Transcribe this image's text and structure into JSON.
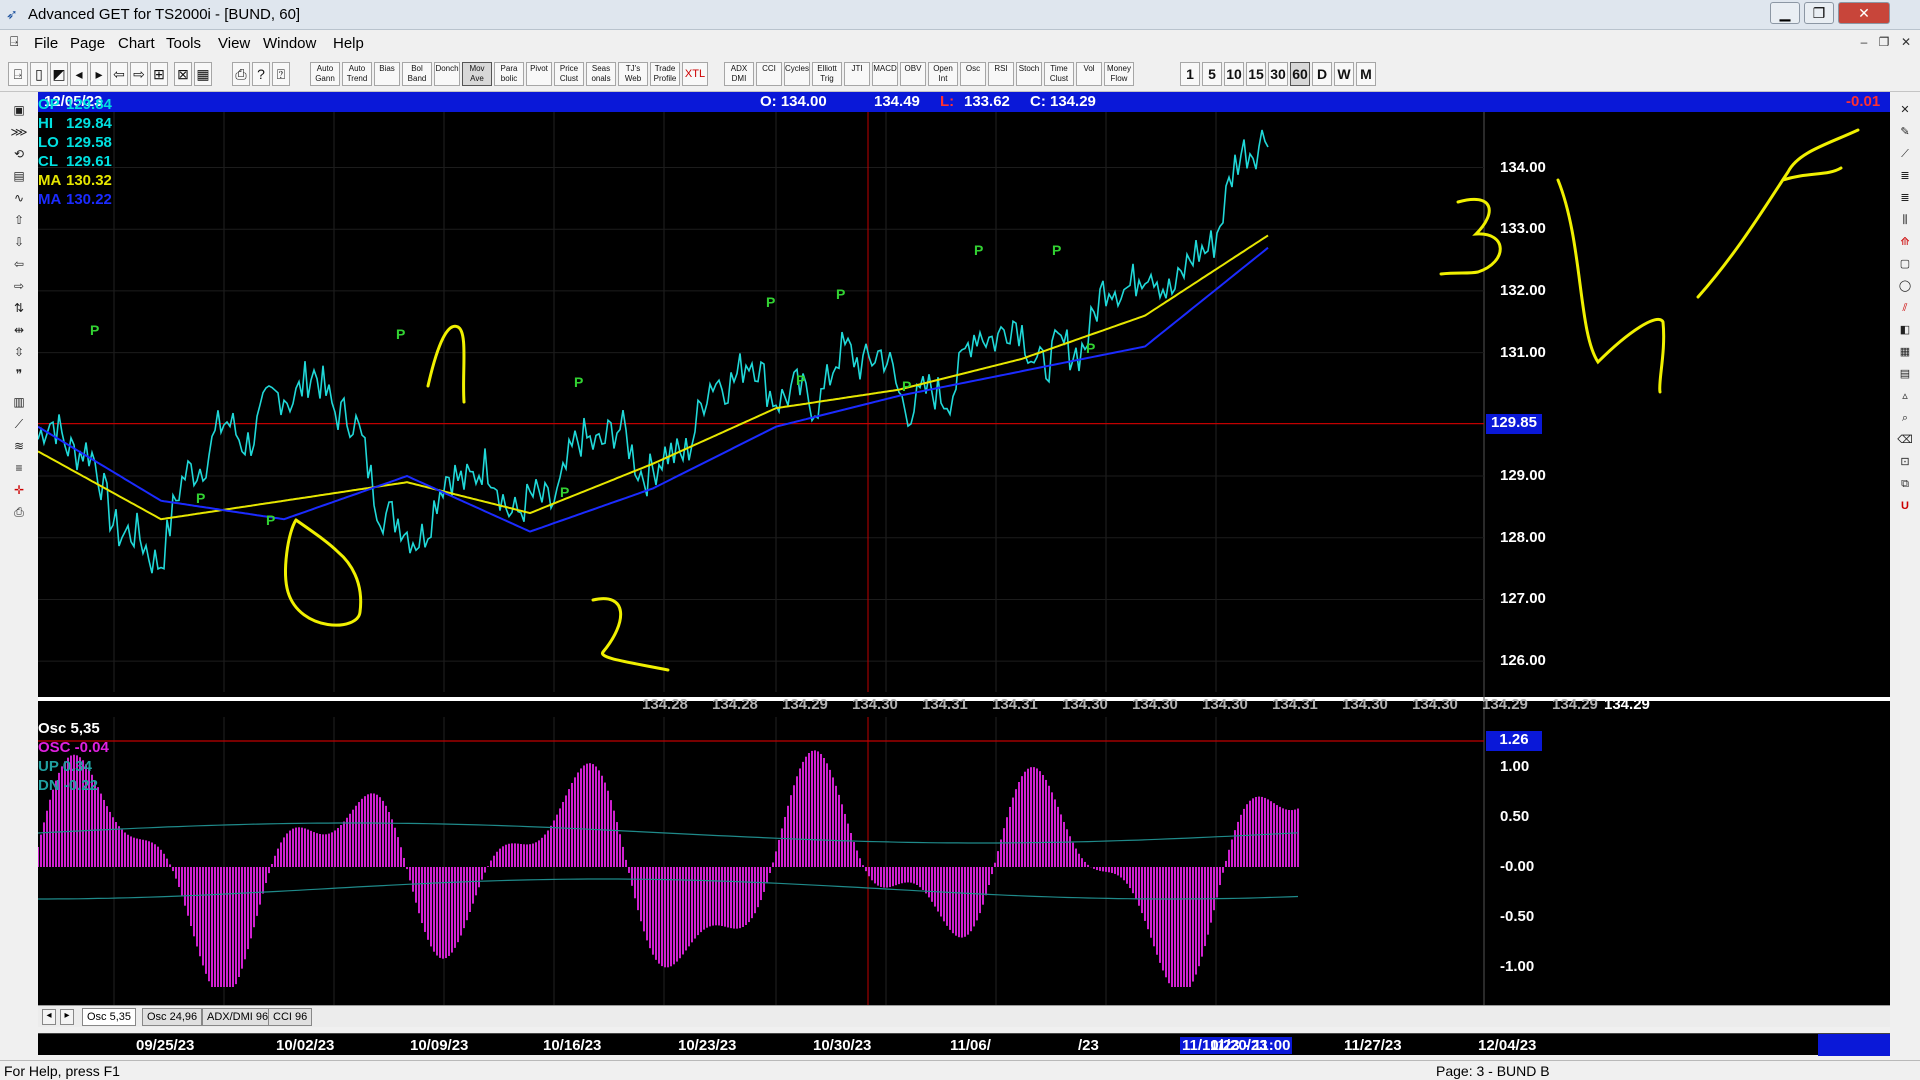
{
  "window": {
    "title": "Advanced GET for TS2000i - [BUND, 60]"
  },
  "menu": [
    "File",
    "Page",
    "Chart",
    "Tools",
    "View",
    "Window",
    "Help"
  ],
  "toolbar": {
    "study_buttons": [
      "Auto Gann",
      "Auto Trend",
      "Bias",
      "Bol Band",
      "Donch",
      "Mov Ave",
      "Para bolic",
      "Pivot",
      "Price Clust",
      "Seas onals",
      "TJ's Web",
      "Trade Profile",
      "XTL",
      "ADX DMI",
      "CCI",
      "Cycles",
      "Elliott Trig",
      "JTI",
      "MACD",
      "OBV",
      "Open Int",
      "Osc",
      "RSI",
      "Stoch",
      "Time Clust",
      "Vol",
      "Money Flow"
    ],
    "period_buttons": [
      "1",
      "5",
      "10",
      "15",
      "30",
      "60",
      "D",
      "W",
      "M"
    ],
    "active_period": "60"
  },
  "chart_header": {
    "date": "12/05/23",
    "open": "O: 134.00",
    "high": "134.49",
    "low_label": "L:",
    "low": "133.62",
    "close": "C: 134.29",
    "change": "-0.01"
  },
  "price_info": [
    {
      "label": "OP",
      "value": "129.84",
      "color": "#00e0e0"
    },
    {
      "label": "HI",
      "value": "129.84",
      "color": "#00e0e0"
    },
    {
      "label": "LO",
      "value": "129.58",
      "color": "#00e0e0"
    },
    {
      "label": "CL",
      "value": "129.61",
      "color": "#00e0e0"
    },
    {
      "label": "MA",
      "value": "130.32",
      "color": "#e6e600"
    },
    {
      "label": "MA",
      "value": "130.22",
      "color": "#1b2bff"
    }
  ],
  "price_axis": [
    "134.00",
    "133.00",
    "132.00",
    "131.00",
    "129.00",
    "128.00",
    "127.00",
    "126.00"
  ],
  "cursor_price": "129.85",
  "bottom_values": [
    "134.28",
    "134.28",
    "134.29",
    "134.30",
    "134.31",
    "134.31",
    "134.30",
    "134.30",
    "134.30",
    "134.31",
    "134.30",
    "134.30",
    "134.29",
    "134.29"
  ],
  "bottom_last": "134.29",
  "osc_info": [
    {
      "label": "Osc 5,35",
      "color": "#ffffff"
    },
    {
      "label": "OSC -0.04",
      "color": "#e020e0"
    },
    {
      "label": "UP  0.34",
      "color": "#20a0a0"
    },
    {
      "label": "DN  -0.22",
      "color": "#20a0a0"
    }
  ],
  "osc_axis": [
    "1.00",
    "0.50",
    "-0.00",
    "-0.50",
    "-1.00"
  ],
  "osc_cursor_value": "1.26",
  "tabs": [
    "Osc 5,35",
    "Osc 24,96",
    "ADX/DMI 96",
    "CCI 96"
  ],
  "date_axis": [
    "09/25/23",
    "10/02/23",
    "10/09/23",
    "10/16/23",
    "10/23/23",
    "10/30/23",
    "11/06/",
    "/23",
    "11/20/23",
    "11/27/23",
    "12/04/23"
  ],
  "date_cursor": "11/10/23 - 11:00",
  "status": {
    "help": "For Help, press F1",
    "page": "Page: 3 - BUND B"
  },
  "annotations": [
    "1",
    "2",
    "3",
    "4",
    "5"
  ],
  "colors": {
    "price": "#20d8d8",
    "ma_fast": "#e6e600",
    "ma_slow": "#1b2bff",
    "osc": "#d020d0",
    "pivot": "#32d232",
    "annotation": "#f0f000",
    "cursor": "#c00000",
    "header": "#0a18d8"
  },
  "chart_data": {
    "type": "line",
    "x": [
      "09/25/23",
      "10/02/23",
      "10/09/23",
      "10/16/23",
      "10/23/23",
      "10/30/23",
      "11/06/23",
      "11/13/23",
      "11/20/23",
      "11/27/23",
      "12/04/23"
    ],
    "series": [
      {
        "values": [
          129.6,
          128.0,
          130.8,
          128.4,
          128.9,
          129.5,
          130.7,
          130.5,
          131.1,
          131.9,
          134.3
        ]
      },
      {
        "values": [
          129.4,
          128.3,
          128.6,
          128.9,
          128.4,
          129.2,
          130.1,
          130.4,
          130.9,
          131.6,
          132.9
        ]
      },
      {
        "values": [
          129.8,
          128.6,
          128.3,
          129.0,
          128.1,
          128.8,
          129.8,
          130.3,
          130.7,
          131.1,
          132.7
        ]
      }
    ],
    "ylim": [
      125.5,
      134.9
    ]
  }
}
